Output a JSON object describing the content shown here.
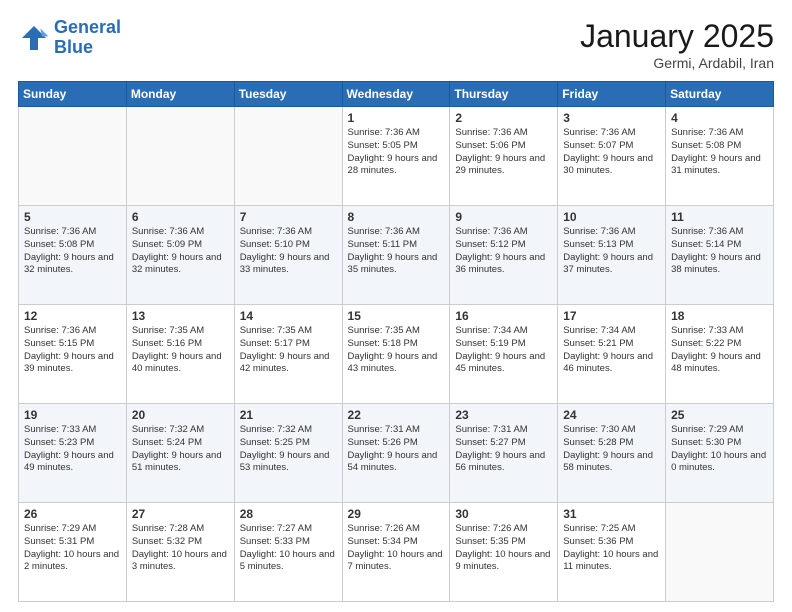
{
  "logo": {
    "line1": "General",
    "line2": "Blue"
  },
  "title": "January 2025",
  "subtitle": "Germi, Ardabil, Iran",
  "days_of_week": [
    "Sunday",
    "Monday",
    "Tuesday",
    "Wednesday",
    "Thursday",
    "Friday",
    "Saturday"
  ],
  "weeks": [
    [
      {
        "day": "",
        "info": ""
      },
      {
        "day": "",
        "info": ""
      },
      {
        "day": "",
        "info": ""
      },
      {
        "day": "1",
        "info": "Sunrise: 7:36 AM\nSunset: 5:05 PM\nDaylight: 9 hours\nand 28 minutes."
      },
      {
        "day": "2",
        "info": "Sunrise: 7:36 AM\nSunset: 5:06 PM\nDaylight: 9 hours\nand 29 minutes."
      },
      {
        "day": "3",
        "info": "Sunrise: 7:36 AM\nSunset: 5:07 PM\nDaylight: 9 hours\nand 30 minutes."
      },
      {
        "day": "4",
        "info": "Sunrise: 7:36 AM\nSunset: 5:08 PM\nDaylight: 9 hours\nand 31 minutes."
      }
    ],
    [
      {
        "day": "5",
        "info": "Sunrise: 7:36 AM\nSunset: 5:08 PM\nDaylight: 9 hours\nand 32 minutes."
      },
      {
        "day": "6",
        "info": "Sunrise: 7:36 AM\nSunset: 5:09 PM\nDaylight: 9 hours\nand 32 minutes."
      },
      {
        "day": "7",
        "info": "Sunrise: 7:36 AM\nSunset: 5:10 PM\nDaylight: 9 hours\nand 33 minutes."
      },
      {
        "day": "8",
        "info": "Sunrise: 7:36 AM\nSunset: 5:11 PM\nDaylight: 9 hours\nand 35 minutes."
      },
      {
        "day": "9",
        "info": "Sunrise: 7:36 AM\nSunset: 5:12 PM\nDaylight: 9 hours\nand 36 minutes."
      },
      {
        "day": "10",
        "info": "Sunrise: 7:36 AM\nSunset: 5:13 PM\nDaylight: 9 hours\nand 37 minutes."
      },
      {
        "day": "11",
        "info": "Sunrise: 7:36 AM\nSunset: 5:14 PM\nDaylight: 9 hours\nand 38 minutes."
      }
    ],
    [
      {
        "day": "12",
        "info": "Sunrise: 7:36 AM\nSunset: 5:15 PM\nDaylight: 9 hours\nand 39 minutes."
      },
      {
        "day": "13",
        "info": "Sunrise: 7:35 AM\nSunset: 5:16 PM\nDaylight: 9 hours\nand 40 minutes."
      },
      {
        "day": "14",
        "info": "Sunrise: 7:35 AM\nSunset: 5:17 PM\nDaylight: 9 hours\nand 42 minutes."
      },
      {
        "day": "15",
        "info": "Sunrise: 7:35 AM\nSunset: 5:18 PM\nDaylight: 9 hours\nand 43 minutes."
      },
      {
        "day": "16",
        "info": "Sunrise: 7:34 AM\nSunset: 5:19 PM\nDaylight: 9 hours\nand 45 minutes."
      },
      {
        "day": "17",
        "info": "Sunrise: 7:34 AM\nSunset: 5:21 PM\nDaylight: 9 hours\nand 46 minutes."
      },
      {
        "day": "18",
        "info": "Sunrise: 7:33 AM\nSunset: 5:22 PM\nDaylight: 9 hours\nand 48 minutes."
      }
    ],
    [
      {
        "day": "19",
        "info": "Sunrise: 7:33 AM\nSunset: 5:23 PM\nDaylight: 9 hours\nand 49 minutes."
      },
      {
        "day": "20",
        "info": "Sunrise: 7:32 AM\nSunset: 5:24 PM\nDaylight: 9 hours\nand 51 minutes."
      },
      {
        "day": "21",
        "info": "Sunrise: 7:32 AM\nSunset: 5:25 PM\nDaylight: 9 hours\nand 53 minutes."
      },
      {
        "day": "22",
        "info": "Sunrise: 7:31 AM\nSunset: 5:26 PM\nDaylight: 9 hours\nand 54 minutes."
      },
      {
        "day": "23",
        "info": "Sunrise: 7:31 AM\nSunset: 5:27 PM\nDaylight: 9 hours\nand 56 minutes."
      },
      {
        "day": "24",
        "info": "Sunrise: 7:30 AM\nSunset: 5:28 PM\nDaylight: 9 hours\nand 58 minutes."
      },
      {
        "day": "25",
        "info": "Sunrise: 7:29 AM\nSunset: 5:30 PM\nDaylight: 10 hours\nand 0 minutes."
      }
    ],
    [
      {
        "day": "26",
        "info": "Sunrise: 7:29 AM\nSunset: 5:31 PM\nDaylight: 10 hours\nand 2 minutes."
      },
      {
        "day": "27",
        "info": "Sunrise: 7:28 AM\nSunset: 5:32 PM\nDaylight: 10 hours\nand 3 minutes."
      },
      {
        "day": "28",
        "info": "Sunrise: 7:27 AM\nSunset: 5:33 PM\nDaylight: 10 hours\nand 5 minutes."
      },
      {
        "day": "29",
        "info": "Sunrise: 7:26 AM\nSunset: 5:34 PM\nDaylight: 10 hours\nand 7 minutes."
      },
      {
        "day": "30",
        "info": "Sunrise: 7:26 AM\nSunset: 5:35 PM\nDaylight: 10 hours\nand 9 minutes."
      },
      {
        "day": "31",
        "info": "Sunrise: 7:25 AM\nSunset: 5:36 PM\nDaylight: 10 hours\nand 11 minutes."
      },
      {
        "day": "",
        "info": ""
      }
    ]
  ]
}
